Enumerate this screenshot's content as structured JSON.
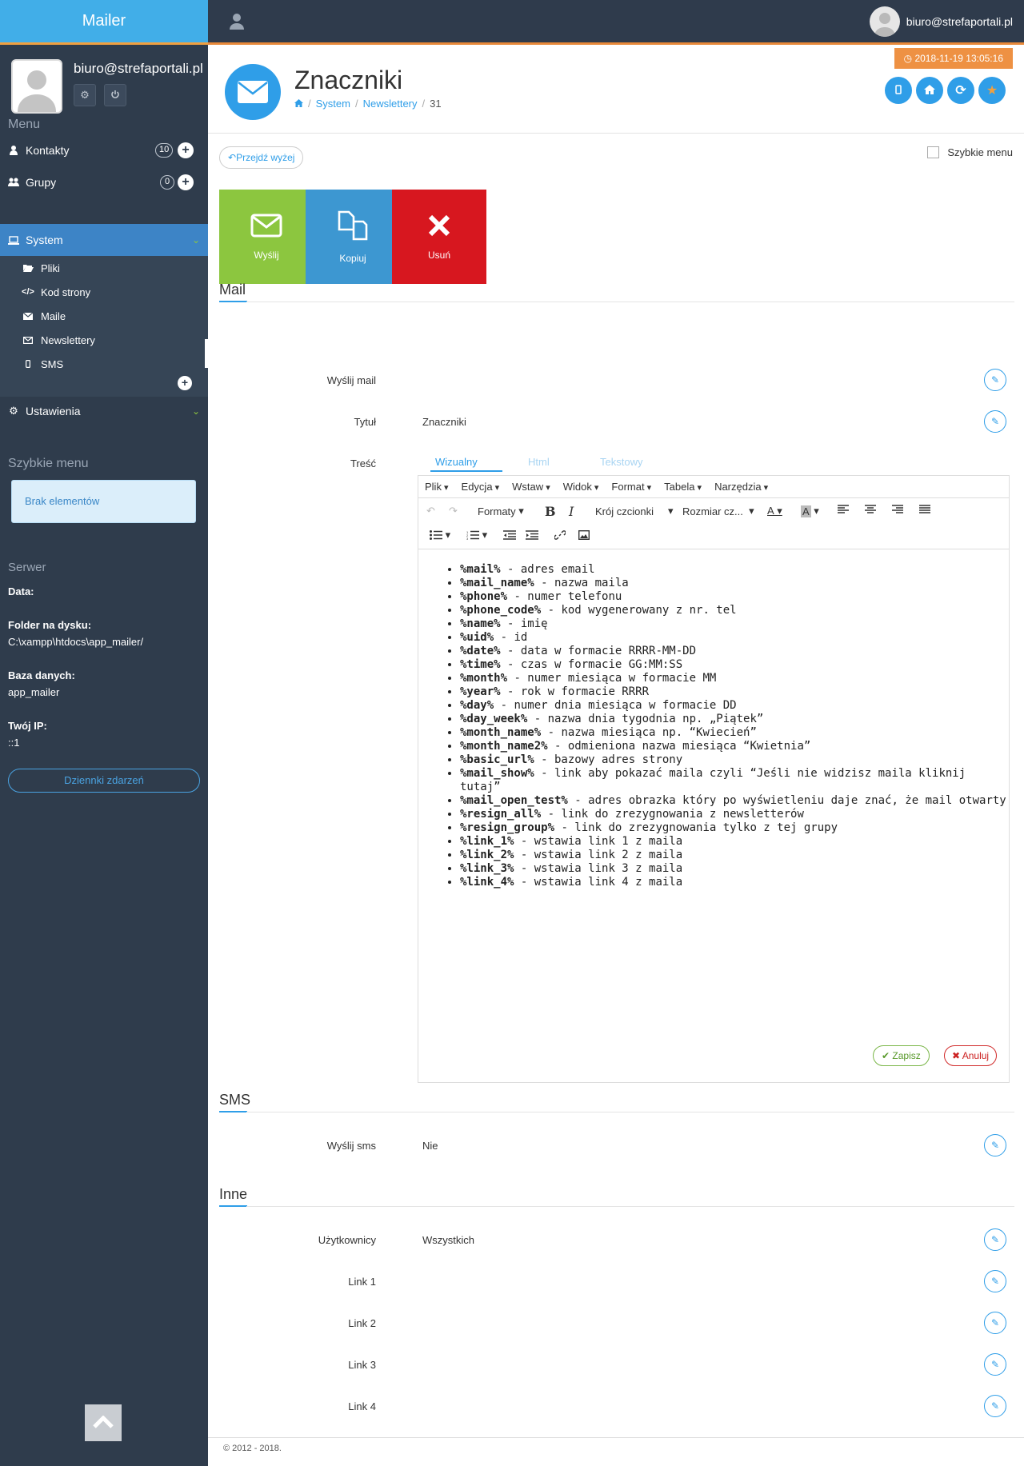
{
  "app": {
    "brand": "Mailer",
    "user_email": "biuro@strefaportali.pl",
    "datetime": "2018-11-19 13:05:16"
  },
  "sidebar": {
    "profile_email": "biuro@strefaportali.pl",
    "menu_heading": "Menu",
    "items": [
      {
        "label": "Kontakty",
        "badge": "10"
      },
      {
        "label": "Grupy",
        "badge": "0"
      },
      {
        "label": "System"
      },
      {
        "label": "Ustawienia"
      }
    ],
    "system_sub": [
      {
        "label": "Pliki"
      },
      {
        "label": "Kod strony"
      },
      {
        "label": "Maile"
      },
      {
        "label": "Newslettery"
      },
      {
        "label": "SMS"
      }
    ],
    "quick_heading": "Szybkie menu",
    "quick_empty": "Brak elementów",
    "server_heading": "Serwer",
    "server": {
      "data_label": "Data:",
      "folder_label": "Folder na dysku:",
      "folder_value": "C:\\xampp\\htdocs\\app_mailer/",
      "db_label": "Baza danych:",
      "db_value": "app_mailer",
      "ip_label": "Twój IP:",
      "ip_value": "::1"
    },
    "logs_button": "Dziennki zdarzeń"
  },
  "page": {
    "title": "Znaczniki",
    "breadcrumb": [
      "System",
      "Newslettery",
      "31"
    ],
    "up_button": "Przejdź wyżej",
    "quick_menu_checkbox": "Szybkie menu",
    "tiles": [
      {
        "label": "Wyślij",
        "color": "#8cc63f"
      },
      {
        "label": "Kopiuj",
        "color": "#3d97d1"
      },
      {
        "label": "Usuń",
        "color": "#d7171f"
      }
    ]
  },
  "sections": {
    "mail": {
      "title": "Mail",
      "send_label": "Wyślij mail",
      "subject_label": "Tytuł",
      "subject_value": "Znaczniki",
      "body_label": "Treść"
    },
    "sms": {
      "title": "SMS",
      "send_label": "Wyślij sms",
      "send_value": "Nie"
    },
    "other": {
      "title": "Inne",
      "users_label": "Użytkownicy",
      "users_value": "Wszystkich",
      "link1": "Link 1",
      "link2": "Link 2",
      "link3": "Link 3",
      "link4": "Link 4"
    }
  },
  "editor": {
    "tabs": [
      "Wizualny",
      "Html",
      "Tekstowy"
    ],
    "menu": [
      "Plik",
      "Edycja",
      "Wstaw",
      "Widok",
      "Format",
      "Tabela",
      "Narzędzia"
    ],
    "formats": "Formaty",
    "font_family": "Krój czcionki",
    "font_size": "Rozmiar cz...",
    "list": [
      {
        "tag": "%mail%",
        "desc": " - adres email"
      },
      {
        "tag": "%mail_name%",
        "desc": " - nazwa maila"
      },
      {
        "tag": "%phone%",
        "desc": " - numer telefonu"
      },
      {
        "tag": "%phone_code%",
        "desc": " - kod wygenerowany z nr. tel"
      },
      {
        "tag": "%name%",
        "desc": " - imię"
      },
      {
        "tag": "%uid%",
        "desc": " - id"
      },
      {
        "tag": "%date%",
        "desc": " - data w formacie RRRR-MM-DD"
      },
      {
        "tag": "%time%",
        "desc": " - czas w formacie GG:MM:SS"
      },
      {
        "tag": "%month%",
        "desc": " - numer miesiąca w formacie MM"
      },
      {
        "tag": "%year%",
        "desc": " - rok w formacie RRRR"
      },
      {
        "tag": "%day%",
        "desc": " - numer dnia miesiąca w formacie DD"
      },
      {
        "tag": "%day_week%",
        "desc": " - nazwa dnia tygodnia np. „Piątek”"
      },
      {
        "tag": "%month_name%",
        "desc": " - nazwa miesiąca np. “Kwiecień”"
      },
      {
        "tag": "%month_name2%",
        "desc": " - odmieniona nazwa miesiąca “Kwietnia”"
      },
      {
        "tag": "%basic_url%",
        "desc": " - bazowy adres strony"
      },
      {
        "tag": "%mail_show%",
        "desc": " - link aby pokazać maila czyli “Jeśli nie widzisz maila kliknij tutaj”"
      },
      {
        "tag": "%mail_open_test%",
        "desc": " - adres obrazka który po wyświetleniu daje znać, że mail otwarty"
      },
      {
        "tag": "%resign_all%",
        "desc": " - link do zrezygnowania z newsletterów"
      },
      {
        "tag": "%resign_group%",
        "desc": " - link do zrezygnowania tylko z tej grupy"
      },
      {
        "tag": "%link_1%",
        "desc": " - wstawia link 1 z maila"
      },
      {
        "tag": "%link_2%",
        "desc": " - wstawia link 2 z maila"
      },
      {
        "tag": "%link_3%",
        "desc": " - wstawia link 3 z maila"
      },
      {
        "tag": "%link_4%",
        "desc": " - wstawia link 4 z maila"
      }
    ],
    "save": "Zapisz",
    "cancel": "Anuluj"
  },
  "footer": "© 2012 - 2018."
}
